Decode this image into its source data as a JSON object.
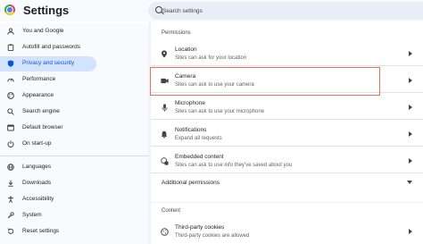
{
  "app": {
    "title": "Settings"
  },
  "search": {
    "placeholder": "Search settings"
  },
  "sidebar": {
    "items": [
      {
        "label": "You and Google",
        "icon": "google-g-icon",
        "active": false
      },
      {
        "label": "Autofill and passwords",
        "icon": "clipboard-icon",
        "active": false
      },
      {
        "label": "Privacy and security",
        "icon": "shield-icon",
        "active": true
      },
      {
        "label": "Performance",
        "icon": "speedometer-icon",
        "active": false
      },
      {
        "label": "Appearance",
        "icon": "palette-icon",
        "active": false
      },
      {
        "label": "Search engine",
        "icon": "search-icon",
        "active": false
      },
      {
        "label": "Default browser",
        "icon": "browser-icon",
        "active": false
      },
      {
        "label": "On start-up",
        "icon": "power-icon",
        "active": false
      },
      {
        "label": "Languages",
        "icon": "globe-icon",
        "active": false
      },
      {
        "label": "Downloads",
        "icon": "download-icon",
        "active": false
      },
      {
        "label": "Accessibility",
        "icon": "accessibility-icon",
        "active": false
      },
      {
        "label": "System",
        "icon": "wrench-icon",
        "active": false
      },
      {
        "label": "Reset settings",
        "icon": "reset-icon",
        "active": false
      }
    ]
  },
  "main": {
    "permissions_title": "Permissions",
    "permissions": [
      {
        "title": "Location",
        "subtitle": "Sites can ask for your location",
        "icon": "location-pin-icon"
      },
      {
        "title": "Camera",
        "subtitle": "Sites can ask to use your camera",
        "icon": "camera-icon"
      },
      {
        "title": "Microphone",
        "subtitle": "Sites can ask to use your microphone",
        "icon": "microphone-icon"
      },
      {
        "title": "Notifications",
        "subtitle": "Expand all requests",
        "icon": "bell-icon"
      },
      {
        "title": "Embedded content",
        "subtitle": "Sites can ask to use info they've saved about you",
        "icon": "embedded-content-icon"
      }
    ],
    "additional_permissions": "Additional permissions",
    "content_title": "Content",
    "content": [
      {
        "title": "Third-party cookies",
        "subtitle": "Third-party cookies are allowed",
        "icon": "cookie-icon"
      }
    ]
  },
  "colors": {
    "accent": "#0b57d0",
    "active_bg": "#d3e3fd",
    "highlight": "#e8705c"
  }
}
